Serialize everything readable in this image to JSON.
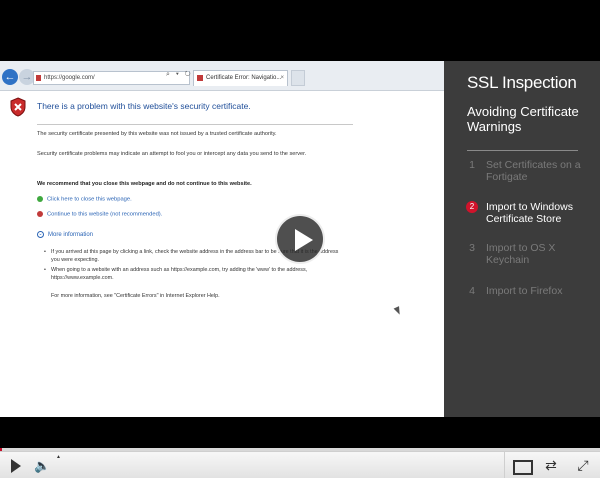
{
  "browser": {
    "url": "https://google.com/",
    "url_tools": "⌕ ▾ ↻",
    "tab_title": "Certificate Error: Navigatio...",
    "tab_close": "×",
    "back_icon": "←",
    "forward_icon": "→"
  },
  "error_page": {
    "title": "There is a problem with this website's security certificate.",
    "para1": "The security certificate presented by this website was not issued by a trusted certificate authority.",
    "para2": "Security certificate problems may indicate an attempt to fool you or intercept any data you send to the server.",
    "recommend": "We recommend that you close this webpage and do not continue to this website.",
    "close_link": "Click here to close this webpage.",
    "continue_link": "Continue to this website (not recommended).",
    "more_info": "More information",
    "more_info_icon": "chevron-down-icon",
    "bullet1": "If you arrived at this page by clicking a link, check the website address in the address bar to be sure that it is the address you were expecting.",
    "bullet2": "When going to a website with an address such as https://example.com, try adding the 'www' to the address, https://www.example.com.",
    "more_text": "For more information, see \"Certificate Errors\" in Internet Explorer Help."
  },
  "side_panel": {
    "title": "SSL Inspection",
    "subtitle": "Avoiding Certificate Warnings",
    "steps": [
      {
        "num": "1",
        "label": "Set Certificates on a Fortigate",
        "active": false
      },
      {
        "num": "2",
        "label": "Import to Windows Certificate Store",
        "active": true
      },
      {
        "num": "3",
        "label": "Import to OS X Keychain",
        "active": false
      },
      {
        "num": "4",
        "label": "Import to Firefox",
        "active": false
      }
    ]
  },
  "player": {
    "progress": 0.0,
    "volume_icon": "🔈",
    "vol_arrow": "▲",
    "share_icon": "⇄",
    "fullscreen_icon": "⤢",
    "accent_color": "#c4102b"
  }
}
